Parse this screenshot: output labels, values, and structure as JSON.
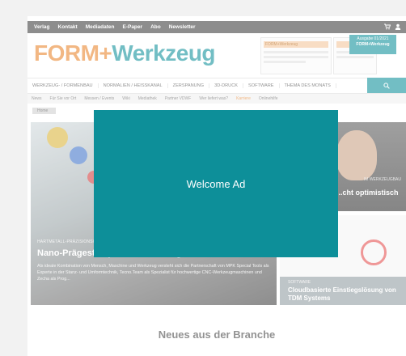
{
  "topbar": {
    "links": [
      "Verlag",
      "Kontakt",
      "Mediadaten",
      "E-Paper",
      "Abo",
      "Newsletter"
    ],
    "icons": [
      "cart-icon",
      "user-icon"
    ]
  },
  "logo": {
    "part1": "FORM+",
    "part2": "Werkzeug"
  },
  "header": {
    "magazine_label": "FORM+Werkzeug",
    "badge_line1": "Ausgabe 01/2021",
    "badge_line2": "FORM+Werkzeug"
  },
  "mainnav": {
    "items": [
      "WERKZEUG- / FORMENBAU",
      "NORMALIEN / HEISSKANAL",
      "ZERSPANUNG",
      "3D-DRUCK",
      "SOFTWARE",
      "THEMA DES MONATS"
    ]
  },
  "subnav": {
    "items": [
      "News",
      "Für Sie vor Ort",
      "Messen / Events",
      "Wiki",
      "Mediathek",
      "Partner VDWF",
      "Wer liefert was?",
      "Karriere",
      "Onlinehilfe"
    ],
    "highlight": "Karriere"
  },
  "breadcrumb": "Home",
  "hero": {
    "kicker": "HARTMETALL-PRÄZISIONSWERKZEUG",
    "title": "Nano-Prägestempel effizient fertigen",
    "text": "Als ideale Kombination von Mensch, Maschine und Werkzeug versteht sich die Partnerschaft von MPK Special Tools als Experte in der Stanz- und Umformtechnik, Tecno.Team als Spezialist für hochwertige CNC-Werkzeugmaschinen und Zecha als Prog..."
  },
  "side1": {
    "kicker": "IM WERKZEUGBAU",
    "title": "...cht optimistisch"
  },
  "side2": {
    "kicker": "SOFTWARE",
    "title": "Cloudbasierte Einstiegslösung von TDM Systems"
  },
  "section_title": "Neues aus der Branche",
  "ad": {
    "label": "Welcome Ad"
  },
  "colors": {
    "accent_teal": "#0d8f99",
    "accent_orange": "#e9842a",
    "topbar": "#3b3b3b"
  }
}
